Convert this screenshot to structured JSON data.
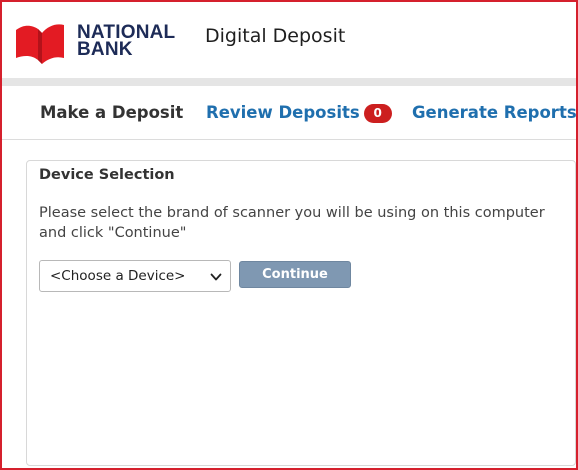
{
  "header": {
    "logo_line1": "NATIONAL",
    "logo_line2": "BANK",
    "app_title": "Digital Deposit",
    "logo_icon": "national-bank-flag-icon",
    "brand_red": "#e31b23",
    "brand_navy": "#1d2b57"
  },
  "nav": {
    "items": [
      {
        "label": "Make a Deposit"
      },
      {
        "label": "Review Deposits",
        "badge": "0"
      },
      {
        "label": "Generate Reports"
      }
    ],
    "active_color": "#333333",
    "link_color": "#1f6fae",
    "badge_color": "#cc1f1f"
  },
  "panel": {
    "title": "Device Selection",
    "description": "Please select the brand of scanner you will be using on this computer and click \"Continue\"",
    "device_select": {
      "selected": "<Choose a Device>",
      "icon": "chevron-down-icon"
    },
    "continue_label": "Continue",
    "continue_color": "#7f98b2"
  }
}
